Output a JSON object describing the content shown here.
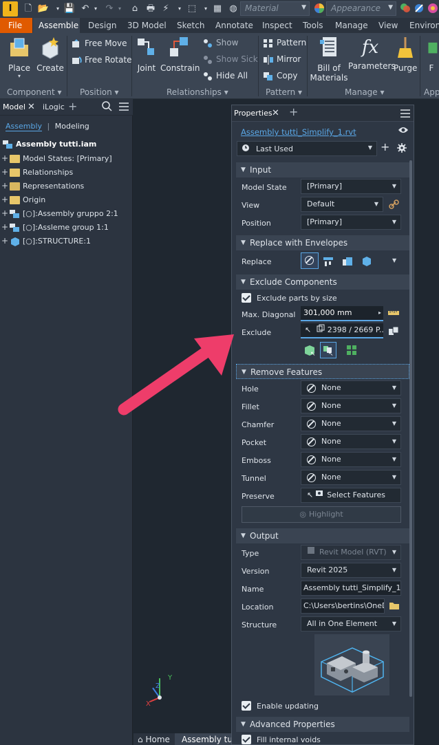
{
  "qab": {
    "app_letter": "I",
    "material_placeholder": "Material",
    "appearance_placeholder": "Appearance"
  },
  "tabs": [
    "File",
    "Assemble",
    "Design",
    "3D Model",
    "Sketch",
    "Annotate",
    "Inspect",
    "Tools",
    "Manage",
    "View",
    "Environme"
  ],
  "ribbon": {
    "place": "Place",
    "create": "Create",
    "free_move": "Free Move",
    "free_rotate": "Free Rotate",
    "joint": "Joint",
    "constrain": "Constrain",
    "show": "Show",
    "show_sick": "Show Sick",
    "hide_all": "Hide All",
    "pattern": "Pattern",
    "mirror": "Mirror",
    "copy": "Copy",
    "bill_of_materials_1": "Bill of",
    "bill_of_materials_2": "Materials",
    "parameters": "Parameters",
    "purge": "Purge",
    "panel_component": "Component",
    "panel_position": "Position",
    "panel_relationships": "Relationships",
    "panel_pattern": "Pattern",
    "panel_manage": "Manage",
    "panel_app": "App",
    "partial_f": "F"
  },
  "browser": {
    "tab_model": "Model",
    "tab_ilogic": "iLogic",
    "sub_assembly": "Assembly",
    "sub_modeling": "Modeling",
    "root": "Assembly tutti.iam",
    "items": [
      "Model States: [Primary]",
      "Relationships",
      "Representations",
      "Origin",
      "[○]:Assembly gruppo 2:1",
      "[○]:Assleme group 1:1",
      "[○]:STRUCTURE:1"
    ]
  },
  "props": {
    "title": "Properties",
    "file_link": "Assembly tutti_Simplify_1.rvt",
    "preset": "Last Used",
    "sections": {
      "input": "Input",
      "replace": "Replace with Envelopes",
      "exclude": "Exclude Components",
      "remove": "Remove Features",
      "output": "Output",
      "advanced": "Advanced Properties"
    },
    "input": {
      "model_state_label": "Model State",
      "model_state_value": "[Primary]",
      "view_label": "View",
      "view_value": "Default",
      "position_label": "Position",
      "position_value": "[Primary]"
    },
    "replace_label": "Replace",
    "exclude": {
      "by_size": "Exclude parts by size",
      "max_diag_label": "Max. Diagonal",
      "max_diag_value": "301,000 mm",
      "exclude_label": "Exclude",
      "exclude_value": "2398 / 2669 P..."
    },
    "features": [
      {
        "label": "Hole",
        "value": "None"
      },
      {
        "label": "Fillet",
        "value": "None"
      },
      {
        "label": "Chamfer",
        "value": "None"
      },
      {
        "label": "Pocket",
        "value": "None"
      },
      {
        "label": "Emboss",
        "value": "None"
      },
      {
        "label": "Tunnel",
        "value": "None"
      }
    ],
    "preserve_label": "Preserve",
    "preserve_value": "Select Features",
    "highlight": "Highlight",
    "output": {
      "type_label": "Type",
      "type_value": "Revit Model (RVT)",
      "version_label": "Version",
      "version_value": "Revit 2025",
      "name_label": "Name",
      "name_value": "Assembly tutti_Simplify_1",
      "location_label": "Location",
      "location_value": "C:\\Users\\bertins\\OneDri",
      "structure_label": "Structure",
      "structure_value": "All in One Element"
    },
    "enable_updating": "Enable updating",
    "fill_voids": "Fill internal voids"
  },
  "bottom": {
    "home": "Home",
    "doc": "Assembly tutt"
  },
  "triad": {
    "x": "X",
    "y": "Y",
    "z": "Z"
  },
  "colors": {
    "accent_orange": "#e05a00",
    "arrow_pink": "#ee3d6a",
    "link_blue": "#5aa7e6"
  }
}
